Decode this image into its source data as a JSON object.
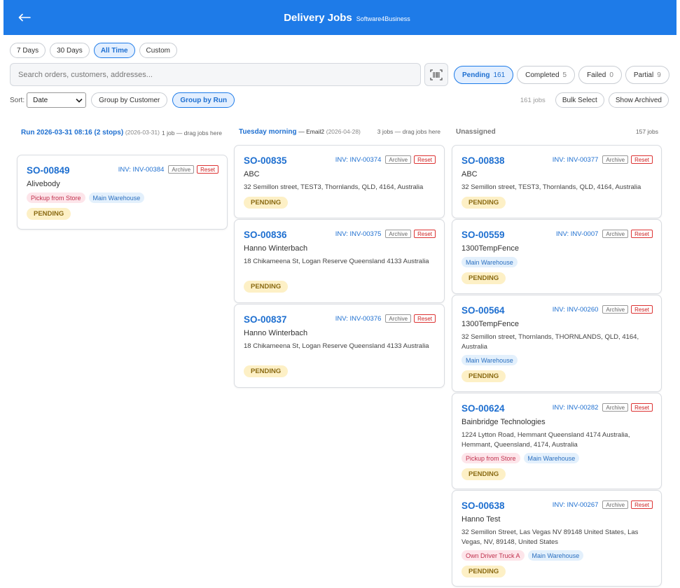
{
  "header": {
    "back_icon": "arrow-left-icon",
    "title": "Delivery Jobs",
    "subtitle": "Software4Business",
    "bg_color": "#1e7be8"
  },
  "date_filters": [
    {
      "label": "7 Days",
      "active": false
    },
    {
      "label": "30 Days",
      "active": false
    },
    {
      "label": "All Time",
      "active": true
    },
    {
      "label": "Custom",
      "active": false
    }
  ],
  "search": {
    "placeholder": "Search orders, customers, addresses..."
  },
  "scan_icon": "barcode-scan-icon",
  "status_filters": [
    {
      "label": "Pending",
      "count": "161",
      "active": true
    },
    {
      "label": "Completed",
      "count": "5",
      "active": false
    },
    {
      "label": "Failed",
      "count": "0",
      "active": false
    },
    {
      "label": "Partial",
      "count": "9",
      "active": false
    }
  ],
  "toolbar": {
    "sort_label": "Sort:",
    "sort_value": "Date",
    "group_customer": "Group by Customer",
    "group_run": "Group by Run",
    "job_count": "161 jobs",
    "bulk_select": "Bulk Select",
    "show_archived": "Show Archived"
  },
  "columns": [
    {
      "title": "Run 2026-03-31 08:16 (2 stops)",
      "meta": "(2026-03-31)",
      "hint": "1 job — drag jobs here",
      "cards": [
        {
          "so": "SO-00849",
          "inv": "INV: INV-00384",
          "customer": "Alivebody",
          "address": "",
          "tags": [
            {
              "label": "Pickup from Store",
              "kind": "pink"
            },
            {
              "label": "Main Warehouse",
              "kind": "blue"
            }
          ],
          "status": "PENDING"
        }
      ]
    },
    {
      "title": "Tuesday morning",
      "title_extra": "— Email2",
      "meta": "(2026-04-28)",
      "hint": "3 jobs — drag jobs here",
      "cards": [
        {
          "so": "SO-00835",
          "inv": "INV: INV-00374",
          "customer": "ABC",
          "address": "32 Semillon street, TEST3, Thornlands, QLD, 4164, Australia",
          "tags": [],
          "status": "PENDING"
        },
        {
          "so": "SO-00836",
          "inv": "INV: INV-00375",
          "customer": "Hanno Winterbach",
          "address": "18 Chikameena St, Logan Reserve Queensland 4133 Australia",
          "tags": [],
          "status": "PENDING"
        },
        {
          "so": "SO-00837",
          "inv": "INV: INV-00376",
          "customer": "Hanno Winterbach",
          "address": "18 Chikameena St, Logan Reserve Queensland 4133 Australia",
          "tags": [],
          "status": "PENDING"
        }
      ]
    },
    {
      "title": "Unassigned",
      "hint": "157 jobs",
      "cards": [
        {
          "so": "SO-00838",
          "inv": "INV: INV-00377",
          "customer": "ABC",
          "address": "32 Semillon street, TEST3, Thornlands, QLD, 4164, Australia",
          "tags": [],
          "status": "PENDING"
        },
        {
          "so": "SO-00559",
          "inv": "INV: INV-0007",
          "customer": "1300TempFence",
          "address": "",
          "tags": [
            {
              "label": "Main Warehouse",
              "kind": "blue"
            }
          ],
          "status": "PENDING"
        },
        {
          "so": "SO-00564",
          "inv": "INV: INV-00260",
          "customer": "1300TempFence",
          "address": "32 Semillon street, Thornlands, THORNLANDS, QLD, 4164, Australia",
          "tags": [
            {
              "label": "Main Warehouse",
              "kind": "blue"
            }
          ],
          "status": "PENDING"
        },
        {
          "so": "SO-00624",
          "inv": "INV: INV-00282",
          "customer": "Bainbridge Technologies",
          "address": "1224 Lytton Road, Hemmant Queensland 4174 Australia, Hemmant, Queensland, 4174, Australia",
          "tags": [
            {
              "label": "Pickup from Store",
              "kind": "pink"
            },
            {
              "label": "Main Warehouse",
              "kind": "blue"
            }
          ],
          "status": "PENDING"
        },
        {
          "so": "SO-00638",
          "inv": "INV: INV-00267",
          "customer": "Hanno Test",
          "address": "32 Semillon Street, Las Vegas NV 89148 United States, Las Vegas, NV, 89148, United States",
          "tags": [
            {
              "label": "Own Driver Truck A",
              "kind": "pink"
            },
            {
              "label": "Main Warehouse",
              "kind": "blue"
            }
          ],
          "status": "PENDING"
        }
      ]
    }
  ],
  "card_actions": {
    "archive": "Archive",
    "reset": "Reset"
  }
}
